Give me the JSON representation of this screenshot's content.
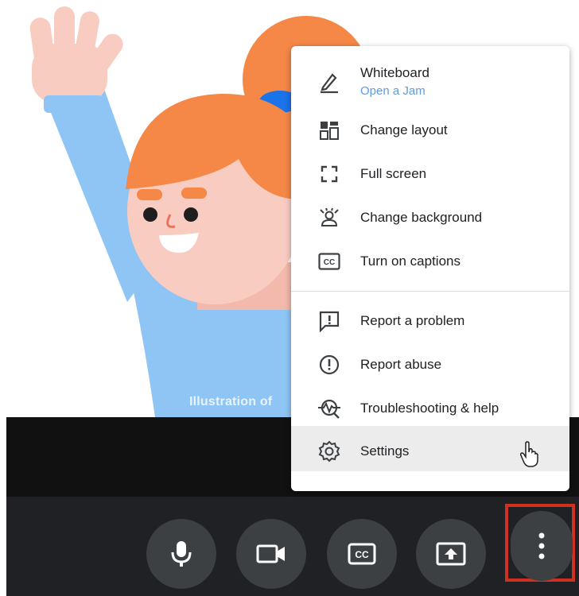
{
  "illustration": {
    "caption": "Illustration of"
  },
  "menu": {
    "items": [
      {
        "label": "Whiteboard",
        "sublabel": "Open a Jam",
        "icon": "pen-icon"
      },
      {
        "label": "Change layout",
        "icon": "layout-icon"
      },
      {
        "label": "Full screen",
        "icon": "fullscreen-icon"
      },
      {
        "label": "Change background",
        "icon": "background-icon"
      },
      {
        "label": "Turn on captions",
        "icon": "captions-icon"
      },
      {
        "label": "Report a problem",
        "icon": "report-problem-icon"
      },
      {
        "label": "Report abuse",
        "icon": "report-abuse-icon"
      },
      {
        "label": "Troubleshooting & help",
        "icon": "troubleshooting-icon"
      },
      {
        "label": "Settings",
        "icon": "settings-icon",
        "hovered": true
      }
    ]
  },
  "toolbar": {
    "buttons": [
      {
        "name": "microphone",
        "icon": "mic-icon"
      },
      {
        "name": "camera",
        "icon": "camera-icon"
      },
      {
        "name": "captions",
        "icon": "cc-icon"
      },
      {
        "name": "present",
        "icon": "present-icon"
      },
      {
        "name": "more-options",
        "icon": "more-vert-icon",
        "highlighted": true
      }
    ]
  },
  "colors": {
    "toolbar_bg": "#202124",
    "button_bg": "#3c4043",
    "highlight_border": "#d0301f",
    "hair": "#f58747",
    "sleeve": "#8ec5f5",
    "skin": "#f9ccc2",
    "sublabel": "#5f9bdc"
  }
}
